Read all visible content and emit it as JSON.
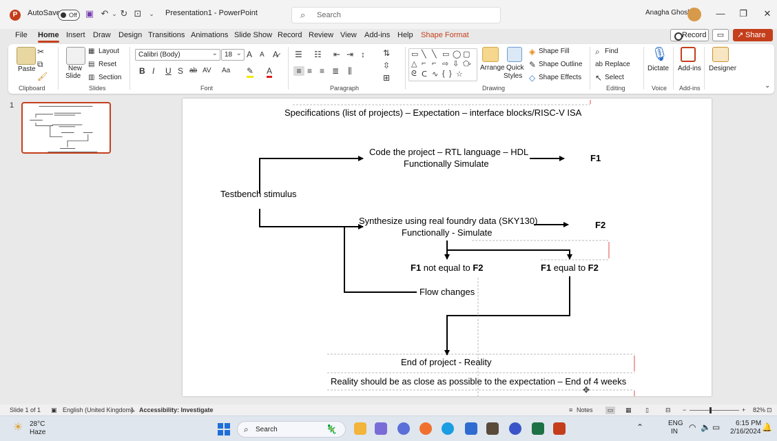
{
  "titlebar": {
    "autosave_label": "AutoSave",
    "autosave_state": "Off",
    "document_title": "Presentation1  -  PowerPoint",
    "search_placeholder": "Search",
    "user_name": "Anagha Ghosh"
  },
  "tabs": [
    "File",
    "Home",
    "Insert",
    "Draw",
    "Design",
    "Transitions",
    "Animations",
    "Slide Show",
    "Record",
    "Review",
    "View",
    "Add-ins",
    "Help",
    "Shape Format"
  ],
  "active_tab": "Home",
  "header_buttons": {
    "record": "Record",
    "share": "Share"
  },
  "ribbon": {
    "clipboard": {
      "paste": "Paste",
      "label": "Clipboard"
    },
    "slides": {
      "new_slide_1": "New",
      "new_slide_2": "Slide",
      "layout": "Layout",
      "reset": "Reset",
      "section": "Section",
      "label": "Slides"
    },
    "font": {
      "family": "Calibri (Body)",
      "size": "18",
      "label": "Font"
    },
    "paragraph": {
      "label": "Paragraph"
    },
    "drawing": {
      "arrange": "Arrange",
      "quick_styles_1": "Quick",
      "quick_styles_2": "Styles",
      "shape_fill": "Shape Fill",
      "shape_outline": "Shape Outline",
      "shape_effects": "Shape Effects",
      "label": "Drawing"
    },
    "editing": {
      "find": "Find",
      "replace": "Replace",
      "select": "Select",
      "label": "Editing"
    },
    "voice": {
      "dictate": "Dictate",
      "label": "Voice"
    },
    "addins": {
      "addins": "Add-ins",
      "label": "Add-ins"
    },
    "designer": {
      "designer": "Designer"
    }
  },
  "thumbnail": {
    "number": "1"
  },
  "slide": {
    "title": "Specifications (list of projects) – Expectation – interface blocks/RISC-V ISA",
    "code_line1": "Code the project – RTL language – HDL",
    "code_line2": "Functionally Simulate",
    "f1": "F1",
    "testbench": "Testbench stimulus",
    "synth_line1": "Synthesize using real foundry data (SKY130)",
    "synth_line2": "Functionally - Simulate",
    "f2": "F2",
    "not_equal_f1": "F1",
    "not_equal_text": " not equal to ",
    "not_equal_f2": "F2",
    "equal_f1": "F1",
    "equal_text": " equal to ",
    "equal_f2": "F2",
    "flow_changes": "Flow changes",
    "end_project": "End of project - Reality",
    "reality": "Reality should be as close as possible to the expectation – End of 4 weeks"
  },
  "statusbar": {
    "slide_of": "Slide 1 of 1",
    "language": "English (United Kingdom)",
    "accessibility": "Accessibility: Investigate",
    "notes": "Notes",
    "zoom": "82%"
  },
  "taskbar": {
    "weather_temp": "28°C",
    "weather_desc": "Haze",
    "search": "Search",
    "lang_1": "ENG",
    "lang_2": "IN",
    "time": "6:15 PM",
    "date": "2/16/2024"
  },
  "colors": {
    "accent": "#c43e1c",
    "start": "#1e6fd9"
  }
}
